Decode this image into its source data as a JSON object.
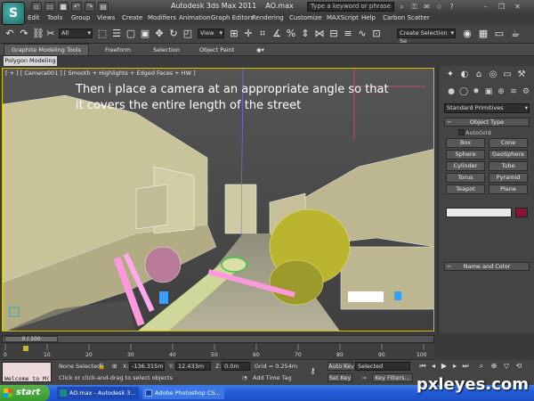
{
  "window": {
    "title": "Autodesk 3ds Max  2011",
    "file": "AO.max",
    "search_placeholder": "Type a keyword or phrase",
    "logo_glyph": "S"
  },
  "menu": [
    "Edit",
    "Tools",
    "Group",
    "Views",
    "Create",
    "Modifiers",
    "Animation",
    "Graph Editors",
    "Rendering",
    "Customize",
    "MAXScript",
    "Help",
    "Carbon Scatter"
  ],
  "toolbar": {
    "selection_filter": "All",
    "ref_coord": "View",
    "named_selection": "Create Selection Se"
  },
  "ribbon": {
    "tabs": [
      "Graphite Modeling Tools",
      "Freeform",
      "Selection",
      "Object Paint"
    ],
    "active_panel": "Polygon Modeling"
  },
  "viewport": {
    "label": "[ + ] [ Camera001 ] [ Smooth + Highlights + Edged Faces + HW ]",
    "overlay_text": "Then i place a camera at an appropriate angle so that it covers the entire length of the street"
  },
  "command_panel": {
    "primitive_type": "Standard Primitives",
    "object_type_title": "Object Type",
    "autogrid_label": "AutoGrid",
    "buttons": [
      "Box",
      "Cone",
      "Sphere",
      "GeoSphere",
      "Cylinder",
      "Tube",
      "Torus",
      "Pyramid",
      "Teapot",
      "Plane"
    ],
    "name_color_title": "Name and Color",
    "object_color": "#8a1436"
  },
  "timeline": {
    "frame_display": "0 / 100",
    "ticks": [
      "0",
      "10",
      "20",
      "30",
      "40",
      "50",
      "60",
      "70",
      "80",
      "90",
      "100"
    ]
  },
  "status": {
    "maxscript_text": "Welcome to M(",
    "selection": "None Selected",
    "prompt": "Click or click-and-drag to select objects",
    "x_label": "X:",
    "x_value": "-136.315m",
    "y_label": "Y:",
    "y_value": "12.433m",
    "z_label": "Z:",
    "z_value": "0.0m",
    "grid": "Grid = 0.254m",
    "add_time_tag": "Add Time Tag",
    "auto_key": "Auto Key",
    "set_key": "Set Key",
    "key_mode": "Selected",
    "key_filters": "Key Filters..."
  },
  "taskbar": {
    "start": "start",
    "tasks": [
      "AO.max - Autodesk 3...",
      "Adobe Photoshop CS..."
    ]
  },
  "watermark": "pxleyes.com",
  "colors": {
    "viewport_border": "#d6c000",
    "taskbar_blue": "#245edb",
    "start_green": "#3a9a2e"
  }
}
